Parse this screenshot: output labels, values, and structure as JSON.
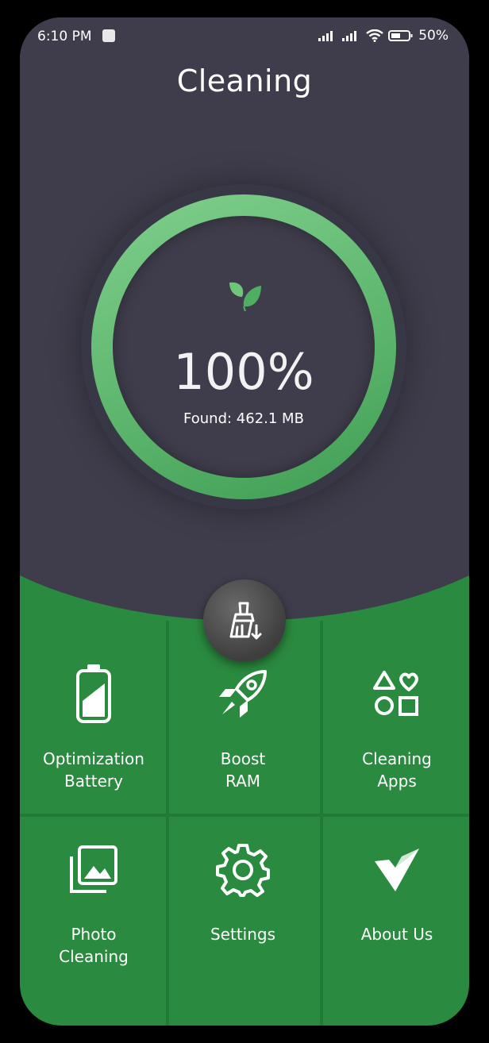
{
  "status_bar": {
    "time": "6:10 PM",
    "battery": "50%"
  },
  "header": {
    "title": "Cleaning"
  },
  "progress": {
    "percent_label": "100%",
    "fraction": 1.0,
    "found_label": "Found: 462.1 MB"
  },
  "fab": {
    "icon": "broom-icon"
  },
  "menu": [
    {
      "line1": "Optimization",
      "line2": "Battery",
      "icon": "battery-icon"
    },
    {
      "line1": "Boost",
      "line2": "RAM",
      "icon": "rocket-icon"
    },
    {
      "line1": "Cleaning",
      "line2": "Apps",
      "icon": "shapes-icon"
    },
    {
      "line1": "Photo",
      "line2": "Cleaning",
      "icon": "photos-icon"
    },
    {
      "line1": "Settings",
      "line2": "",
      "icon": "gear-icon"
    },
    {
      "line1": "About Us",
      "line2": "",
      "icon": "logo-icon"
    }
  ],
  "colors": {
    "dark": "#3f3d4b",
    "green": "#2a8a3f",
    "ring": "#5bb46b"
  }
}
